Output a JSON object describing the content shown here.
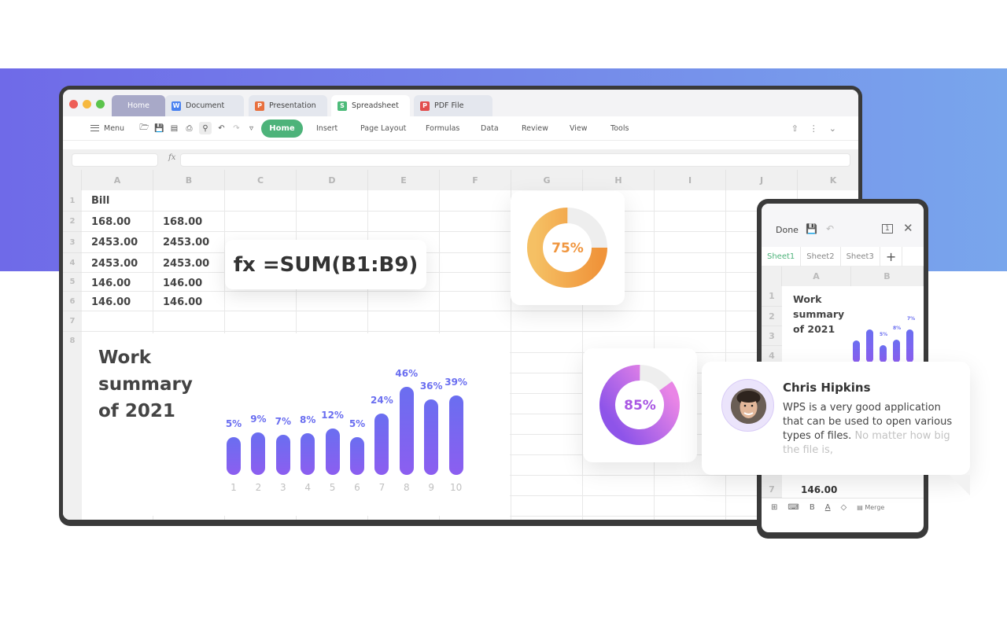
{
  "window": {
    "tabs": [
      {
        "label": "Home",
        "icon": "home"
      },
      {
        "label": "Document",
        "icon": "W"
      },
      {
        "label": "Presentation",
        "icon": "P"
      },
      {
        "label": "Spreadsheet",
        "icon": "S"
      },
      {
        "label": "PDF File",
        "icon": "P"
      }
    ],
    "active_tab": "Spreadsheet"
  },
  "toolbar": {
    "menu_label": "Menu",
    "tool_icons": [
      "open-folder-icon",
      "save-icon",
      "export-pdf-icon",
      "print-icon",
      "print-preview-icon",
      "undo-icon",
      "redo-icon",
      "customize-icon"
    ],
    "ribbon_tabs": [
      "Home",
      "Insert",
      "Page Layout",
      "Formulas",
      "Data",
      "Review",
      "View",
      "Tools"
    ],
    "active_ribbon_tab": "Home",
    "right_icons": [
      "share-icon",
      "more-icon",
      "collapse-icon"
    ]
  },
  "formula_bar": {
    "fx_label": "fx",
    "name_box": "",
    "formula": ""
  },
  "sheet": {
    "columns": [
      "A",
      "B",
      "C",
      "D",
      "E",
      "F",
      "G",
      "H",
      "I",
      "J",
      "K"
    ],
    "rows": [
      "1",
      "2",
      "3",
      "4",
      "5",
      "6",
      "7",
      "8"
    ],
    "cells": {
      "A1": "Bill",
      "A2": "168.00",
      "B2": "168.00",
      "A3": "2453.00",
      "B3": "2453.00",
      "A4": "2453.00",
      "B4": "2453.00",
      "A5": "146.00",
      "B5": "146.00",
      "A6": "146.00",
      "B6": "146.00"
    }
  },
  "formula_popup": "fx =SUM(B1:B9)",
  "summary": {
    "title_lines": [
      "Work",
      "summary",
      "of 2021"
    ]
  },
  "chart_data": {
    "type": "bar",
    "title": "Work summary of 2021",
    "categories": [
      "1",
      "2",
      "3",
      "4",
      "5",
      "6",
      "7",
      "8",
      "9",
      "10"
    ],
    "values": [
      5,
      9,
      7,
      8,
      12,
      5,
      24,
      46,
      36,
      39
    ],
    "value_labels": [
      "5%",
      "9%",
      "7%",
      "8%",
      "12%",
      "5%",
      "24%",
      "46%",
      "36%",
      "39%"
    ],
    "xlabel": "",
    "ylabel": "",
    "grid": false
  },
  "donuts": [
    {
      "label": "75%",
      "value": 75,
      "color_start": "#f5c064",
      "color_end": "#f0943a"
    },
    {
      "label": "85%",
      "value": 85,
      "color_start": "#8e54e9",
      "color_end": "#e985e6"
    }
  ],
  "phone": {
    "done_label": "Done",
    "sheet_tabs": [
      "Sheet1",
      "Sheet2",
      "Sheet3"
    ],
    "active_sheet": "Sheet1",
    "columns": [
      "A",
      "B"
    ],
    "rows": [
      "1",
      "2",
      "3",
      "4",
      "7"
    ],
    "title_lines": [
      "Work",
      "summary",
      "of 2021"
    ],
    "mini_bar_labels": [
      "5%",
      "8%",
      "7%"
    ],
    "cell_row7": "146.00",
    "bottom_tools": [
      "grid-icon",
      "keyboard-icon",
      "B",
      "A",
      "fill-icon",
      "Merge"
    ]
  },
  "review": {
    "name": "Chris Hipkins",
    "text": "WPS is a very good application that can be used to open various types of files.",
    "text_faded": "No matter how big the file is,"
  },
  "colors": {
    "brand_green": "#4db37a",
    "bar_top": "#6a6ef0",
    "bar_bottom": "#8c5ef0",
    "band_left": "#6f6ae8",
    "band_right": "#79a6ec"
  }
}
